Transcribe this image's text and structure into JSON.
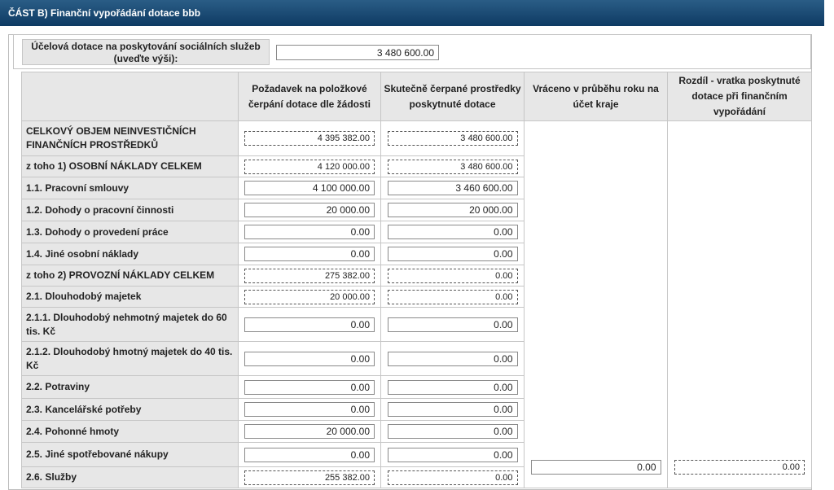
{
  "section": {
    "title": "ČÁST B) Finanční vypořádání dotace bbb"
  },
  "purpose": {
    "label": "Účelová dotace na poskytování sociálních služeb (uveďte výši):",
    "value": "3 480 600.00"
  },
  "table": {
    "headers": {
      "label": "",
      "requested": "Požadavek na položkové čerpání dotace dle žádosti",
      "actual": "Skutečně čerpané prostředky poskytnuté dotace",
      "returned": "Vráceno v průběhu roku na účet kraje",
      "difference": "Rozdíl - vratka poskytnuté dotace při finančním vypořádání"
    },
    "rows": [
      {
        "label": "CELKOVÝ OBJEM NEINVESTIČNÍCH FINANČNÍCH PROSTŘEDKŮ",
        "requested": "4 395 382.00",
        "actual": "3 480 600.00",
        "computed": true
      },
      {
        "label": "z toho 1) OSOBNÍ NÁKLADY CELKEM",
        "requested": "4 120 000.00",
        "actual": "3 480 600.00",
        "computed": true
      },
      {
        "label": "1.1. Pracovní smlouvy",
        "requested": "4 100 000.00",
        "actual": "3 460 600.00",
        "computed": false
      },
      {
        "label": "1.2. Dohody o pracovní činnosti",
        "requested": "20 000.00",
        "actual": "20 000.00",
        "computed": false
      },
      {
        "label": "1.3. Dohody o provedení práce",
        "requested": "0.00",
        "actual": "0.00",
        "computed": false
      },
      {
        "label": "1.4. Jiné osobní náklady",
        "requested": "0.00",
        "actual": "0.00",
        "computed": false
      },
      {
        "label": "z toho 2) PROVOZNÍ NÁKLADY CELKEM",
        "requested": "275 382.00",
        "actual": "0.00",
        "computed": true
      },
      {
        "label": "2.1. Dlouhodobý majetek",
        "requested": "20 000.00",
        "actual": "0.00",
        "computed": true
      },
      {
        "label": "2.1.1. Dlouhodobý nehmotný majetek do 60 tis. Kč",
        "requested": "0.00",
        "actual": "0.00",
        "computed": false
      },
      {
        "label": "2.1.2. Dlouhodobý hmotný majetek do 40 tis. Kč",
        "requested": "0.00",
        "actual": "0.00",
        "computed": false
      },
      {
        "label": "2.2. Potraviny",
        "requested": "0.00",
        "actual": "0.00",
        "computed": false
      },
      {
        "label": "2.3. Kancelářské potřeby",
        "requested": "0.00",
        "actual": "0.00",
        "computed": false
      },
      {
        "label": "2.4. Pohonné hmoty",
        "requested": "20 000.00",
        "actual": "0.00",
        "computed": false
      },
      {
        "label": "2.5. Jiné spotřebované nákupy",
        "requested": "0.00",
        "actual": "0.00",
        "computed": false
      },
      {
        "label": "2.6. Služby",
        "requested": "255 382.00",
        "actual": "0.00",
        "computed": true
      }
    ],
    "returned_value": "0.00",
    "difference_value": "0.00"
  }
}
